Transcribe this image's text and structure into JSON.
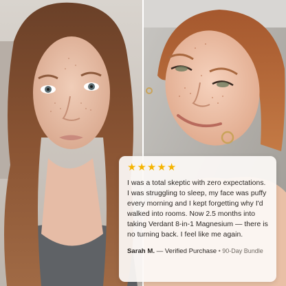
{
  "photos": {
    "left": {
      "name": "before-photo"
    },
    "right": {
      "name": "after-photo"
    }
  },
  "review": {
    "rating": 5,
    "max_rating": 5,
    "star_glyph": "★",
    "star_color": "#f5b400",
    "text": "I was a total skeptic with zero expectations. I was struggling to sleep, my face was puffy every morning and I kept forgetting why I'd walked into rooms. Now 2.5 months into taking Verdant 8-in-1 Magnesium — there is no turning back. I feel like me again.",
    "author": "Sarah M.",
    "verified": " — Verified Purchase",
    "bundle": " • 90-Day Bundle"
  }
}
